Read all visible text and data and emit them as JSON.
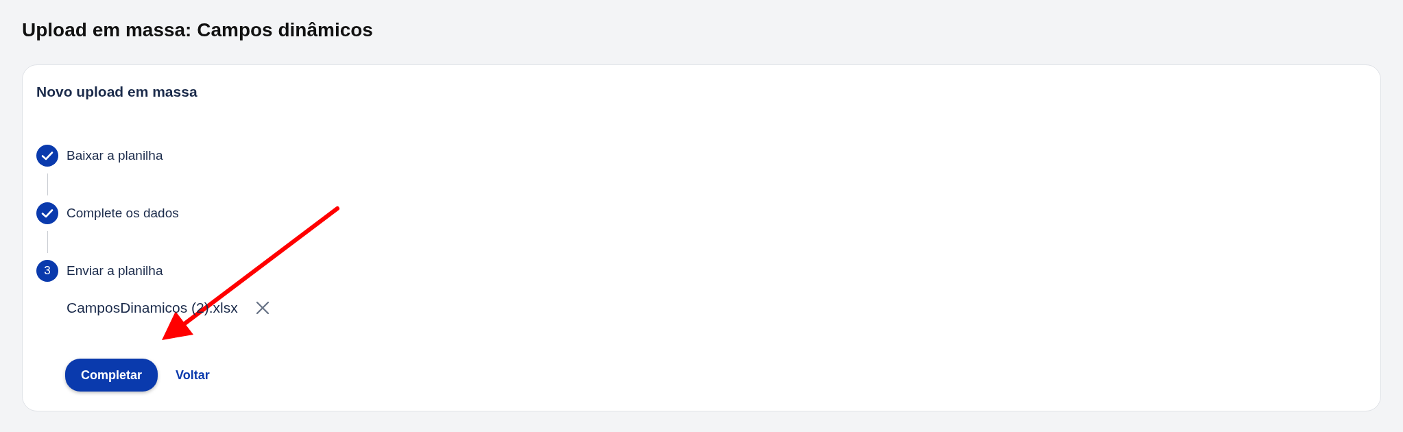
{
  "page_title": "Upload em massa: Campos dinâmicos",
  "card": {
    "title": "Novo upload em massa",
    "steps": [
      {
        "label": "Baixar a planilha",
        "completed": true
      },
      {
        "label": "Complete os dados",
        "completed": true
      },
      {
        "label": "Enviar a planilha",
        "completed": false,
        "number": "3"
      }
    ],
    "file": {
      "name": "CamposDinamicos (2).xlsx"
    },
    "primary_button": "Completar",
    "secondary_link": "Voltar"
  }
}
